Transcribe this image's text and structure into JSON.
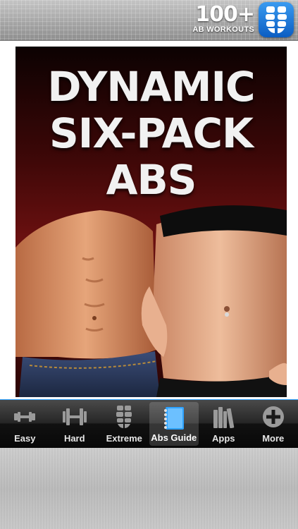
{
  "header": {
    "brand_big": "100+",
    "brand_small": "AB WORKOUTS"
  },
  "cover": {
    "title_lines": [
      "DYNAMIC",
      "SIX-PACK",
      "ABS"
    ]
  },
  "tabs": [
    {
      "label": "Easy",
      "icon": "dumbbell-small-icon",
      "active": false
    },
    {
      "label": "Hard",
      "icon": "dumbbell-large-icon",
      "active": false
    },
    {
      "label": "Extreme",
      "icon": "abs-icon",
      "active": false
    },
    {
      "label": "Abs Guide",
      "icon": "notebook-icon",
      "active": true
    },
    {
      "label": "Apps",
      "icon": "books-icon",
      "active": false
    },
    {
      "label": "More",
      "icon": "plus-circle-icon",
      "active": false
    }
  ],
  "colors": {
    "accent": "#2ea2ff",
    "app_icon": "#1a7ae0",
    "cover_background": "#5a0c0c"
  }
}
